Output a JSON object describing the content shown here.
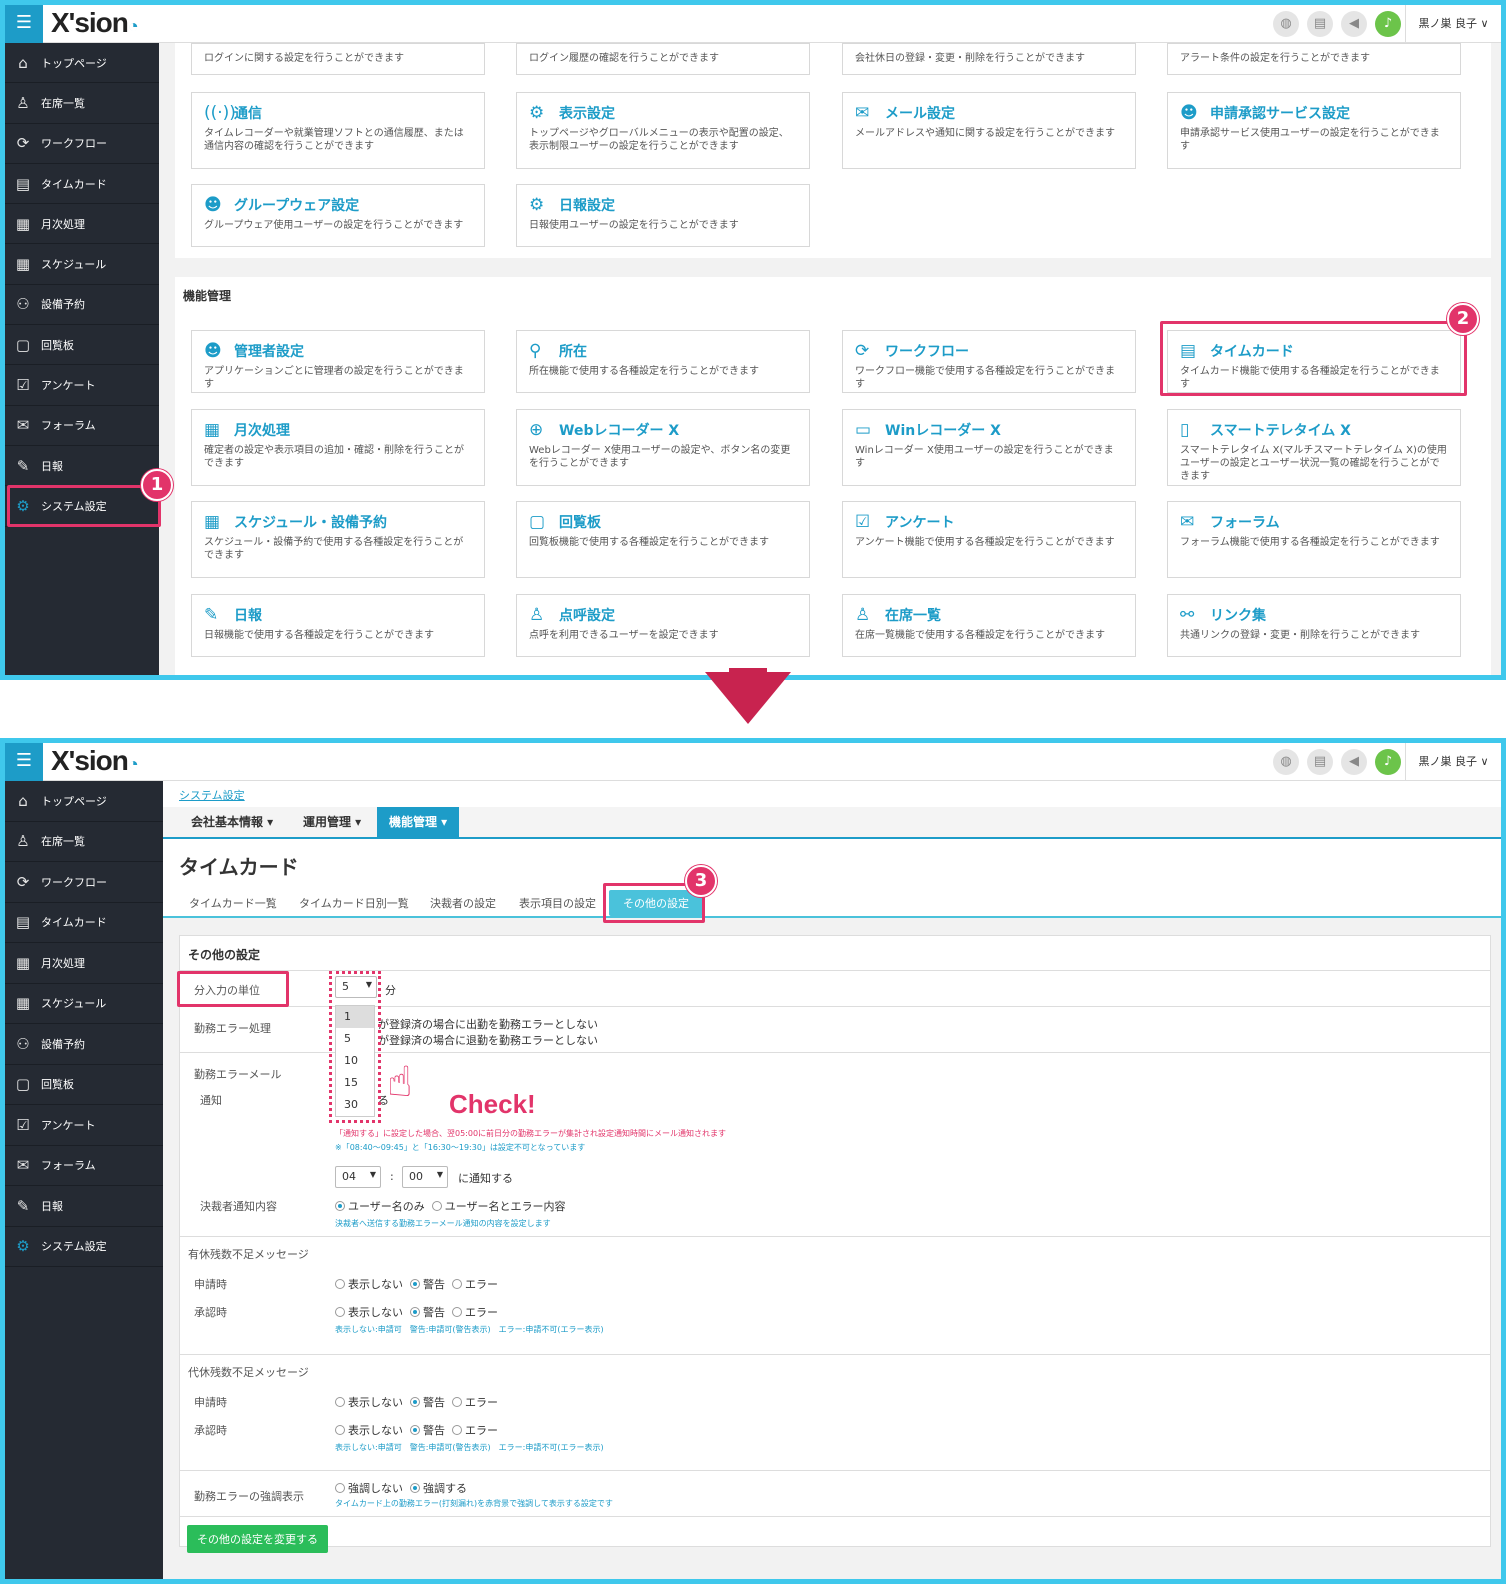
{
  "app": {
    "logo": "X'sion",
    "user": "黒ノ巣 良子 ∨",
    "menu_icon": "☰"
  },
  "sidebar": [
    {
      "label": "トップページ",
      "icon": "home-icon",
      "glyph": "⌂"
    },
    {
      "label": "在席一覧",
      "icon": "person-icon",
      "glyph": "♙"
    },
    {
      "label": "ワークフロー",
      "icon": "workflow-icon",
      "glyph": "⟳"
    },
    {
      "label": "タイムカード",
      "icon": "timecard-icon",
      "glyph": "▤"
    },
    {
      "label": "月次処理",
      "icon": "calendar-31-icon",
      "glyph": "▦"
    },
    {
      "label": "スケジュール",
      "icon": "schedule-icon",
      "glyph": "▦"
    },
    {
      "label": "設備予約",
      "icon": "facility-icon",
      "glyph": "⚇"
    },
    {
      "label": "回覧板",
      "icon": "circular-icon",
      "glyph": "▢"
    },
    {
      "label": "アンケート",
      "icon": "survey-icon",
      "glyph": "☑"
    },
    {
      "label": "フォーラム",
      "icon": "forum-icon",
      "glyph": "✉"
    },
    {
      "label": "日報",
      "icon": "daily-report-icon",
      "glyph": "✎"
    },
    {
      "label": "システム設定",
      "icon": "gear-icon",
      "glyph": "⚙"
    }
  ],
  "screen1": {
    "top_row": [
      "ログインに関する設定を行うことができます",
      "ログイン履歴の確認を行うことができます",
      "会社休日の登録・変更・削除を行うことができます",
      "アラート条件の設定を行うことができます"
    ],
    "cards_a": [
      {
        "title": "通信",
        "icon": "signal-icon",
        "glyph": "((·))",
        "desc": "タイムレコーダーや就業管理ソフトとの通信履歴、または通信内容の確認を行うことができます"
      },
      {
        "title": "表示設定",
        "icon": "display-settings-icon",
        "glyph": "⚙",
        "desc": "トップページやグローバルメニューの表示や配置の設定、表示制限ユーザーの設定を行うことができます"
      },
      {
        "title": "メール設定",
        "icon": "mail-icon",
        "glyph": "✉",
        "desc": "メールアドレスや通知に関する設定を行うことができます"
      },
      {
        "title": "申請承認サービス設定",
        "icon": "approval-icon",
        "glyph": "☻",
        "desc": "申請承認サービス使用ユーザーの設定を行うことができます"
      },
      {
        "title": "グループウェア設定",
        "icon": "groupware-icon",
        "glyph": "☻",
        "desc": "グループウェア使用ユーザーの設定を行うことができます"
      },
      {
        "title": "日報設定",
        "icon": "daily-settings-icon",
        "glyph": "⚙",
        "desc": "日報使用ユーザーの設定を行うことができます"
      }
    ],
    "section_title": "機能管理",
    "cards_b": [
      {
        "title": "管理者設定",
        "icon": "admin-icon",
        "glyph": "☻",
        "desc": "アプリケーションごとに管理者の設定を行うことができます"
      },
      {
        "title": "所在",
        "icon": "location-icon",
        "glyph": "⚲",
        "desc": "所在機能で使用する各種設定を行うことができます"
      },
      {
        "title": "ワークフロー",
        "icon": "workflow-icon",
        "glyph": "⟳",
        "desc": "ワークフロー機能で使用する各種設定を行うことができます"
      },
      {
        "title": "タイムカード",
        "icon": "timecard-icon",
        "glyph": "▤",
        "desc": "タイムカード機能で使用する各種設定を行うことができます"
      },
      {
        "title": "月次処理",
        "icon": "calendar-31-icon",
        "glyph": "▦",
        "desc": "確定者の設定や表示項目の追加・確認・削除を行うことができます"
      },
      {
        "title": "Webレコーダー X",
        "icon": "web-recorder-icon",
        "glyph": "⊕",
        "desc": "Webレコーダー X使用ユーザーの設定や、ボタン名の変更を行うことができます"
      },
      {
        "title": "Winレコーダー X",
        "icon": "win-recorder-icon",
        "glyph": "▭",
        "desc": "Winレコーダー X使用ユーザーの設定を行うことができます"
      },
      {
        "title": "スマートテレタイム X",
        "icon": "smartphone-icon",
        "glyph": "▯",
        "desc": "スマートテレタイム X(マルチスマートテレタイム X)の使用ユーザーの設定とユーザー状況一覧の確認を行うことができます"
      },
      {
        "title": "スケジュール・設備予約",
        "icon": "schedule-icon",
        "glyph": "▦",
        "desc": "スケジュール・設備予約で使用する各種設定を行うことができます"
      },
      {
        "title": "回覧板",
        "icon": "circular-icon",
        "glyph": "▢",
        "desc": "回覧板機能で使用する各種設定を行うことができます"
      },
      {
        "title": "アンケート",
        "icon": "survey-icon",
        "glyph": "☑",
        "desc": "アンケート機能で使用する各種設定を行うことができます"
      },
      {
        "title": "フォーラム",
        "icon": "forum-icon",
        "glyph": "✉",
        "desc": "フォーラム機能で使用する各種設定を行うことができます"
      },
      {
        "title": "日報",
        "icon": "daily-report-icon",
        "glyph": "✎",
        "desc": "日報機能で使用する各種設定を行うことができます"
      },
      {
        "title": "点呼設定",
        "icon": "rollcall-icon",
        "glyph": "♙",
        "desc": "点呼を利用できるユーザーを設定できます"
      },
      {
        "title": "在席一覧",
        "icon": "presence-icon",
        "glyph": "♙",
        "desc": "在席一覧機能で使用する各種設定を行うことができます"
      },
      {
        "title": "リンク集",
        "icon": "link-icon",
        "glyph": "⚯",
        "desc": "共通リンクの登録・変更・削除を行うことができます"
      }
    ],
    "badge1": "1",
    "badge2": "2"
  },
  "screen2": {
    "breadcrumb": "システム設定",
    "nav": [
      "会社基本情報 ▾",
      "運用管理 ▾",
      "機能管理 ▾"
    ],
    "page_title": "タイムカード",
    "subtabs": [
      "タイムカード一覧",
      "タイムカード日別一覧",
      "決裁者の設定",
      "表示項目の設定",
      "その他の設定"
    ],
    "badge3": "3",
    "panel_title": "その他の設定",
    "unit_label": "分入力の単位",
    "unit_value": "5",
    "unit_suffix": "分",
    "unit_options": [
      "1",
      "5",
      "10",
      "15",
      "30"
    ],
    "err_label": "勤務エラー処理",
    "err_line1": "が登録済の場合に出勤を勤務エラーとしない",
    "err_line2": "が登録済の場合に退勤を勤務エラーとしない",
    "mail_label": "勤務エラーメール",
    "notify_label": "通知",
    "notify_fragment": "る",
    "notify_note1": "「通知する」に設定した場合、翌05:00に前日分の勤務エラーが集計され設定通知時間にメール通知されます",
    "notify_note2": "※「08:40～09:45」と「16:30～19:30」は設定不可となっています",
    "time_hour": "04",
    "time_min": "00",
    "time_suffix": "に通知する",
    "approver_label": "決裁者通知内容",
    "approver_opt1": "ユーザー名のみ",
    "approver_opt2": "ユーザー名とエラー内容",
    "approver_note": "決裁者へ送信する勤務エラーメール通知の内容を設定します",
    "paid_title": "有休残数不足メッセージ",
    "sub_title": "代休残数不足メッセージ",
    "apply_label": "申請時",
    "approve_label": "承認時",
    "opt_hide": "表示しない",
    "opt_warn": "警告",
    "opt_err": "エラー",
    "opt_note": "表示しない:申請可　警告:申請可(警告表示)　エラー:申請不可(エラー表示)",
    "emph_label": "勤務エラーの強調表示",
    "emph_off": "強調しない",
    "emph_on": "強調する",
    "emph_note": "タイムカード上の勤務エラー(打刻漏れ)を赤背景で強調して表示する設定です",
    "submit": "その他の設定を変更する",
    "check": "Check!"
  }
}
